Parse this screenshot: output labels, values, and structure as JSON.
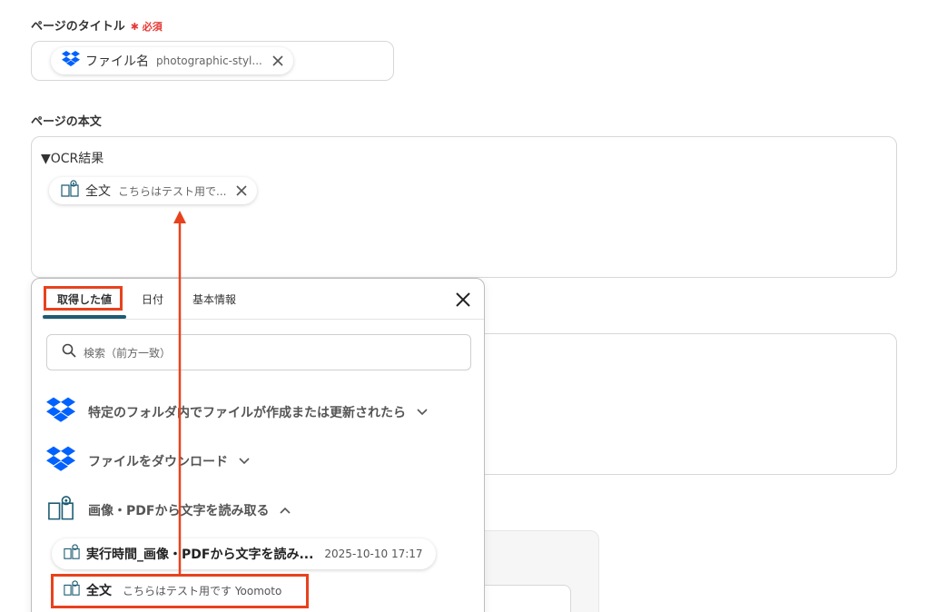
{
  "page_title_field": {
    "label": "ページのタイトル",
    "required": "必須",
    "chip": {
      "title": "ファイル名",
      "value": "photographic-styl..."
    }
  },
  "page_body_field": {
    "label": "ページの本文",
    "text": "▼OCR結果",
    "chip": {
      "title": "全文",
      "value": "こちらはテスト用で..."
    }
  },
  "popup": {
    "tabs": [
      {
        "label": "取得した値"
      },
      {
        "label": "日付"
      },
      {
        "label": "基本情報"
      }
    ],
    "search_placeholder": "検索（前方一致）",
    "groups": [
      {
        "title": "特定のフォルダ内でファイルが作成または更新されたら",
        "icon": "dropbox-icon",
        "expanded": false
      },
      {
        "title": "ファイルをダウンロード",
        "icon": "dropbox-icon",
        "expanded": false
      },
      {
        "title": "画像・PDFから文字を読み取る",
        "icon": "ocr-book-icon",
        "expanded": true
      }
    ],
    "items": [
      {
        "title": "実行時間_画像・PDFから文字を読み...",
        "value": "2025-10-10 17:17"
      },
      {
        "title": "全文",
        "value": "こちらはテスト用です Yoomoto"
      }
    ]
  },
  "colors": {
    "highlight": "#e8421d",
    "tab_underline": "#1d5c73",
    "dropbox": "#0061fe",
    "required": "#e53935"
  }
}
